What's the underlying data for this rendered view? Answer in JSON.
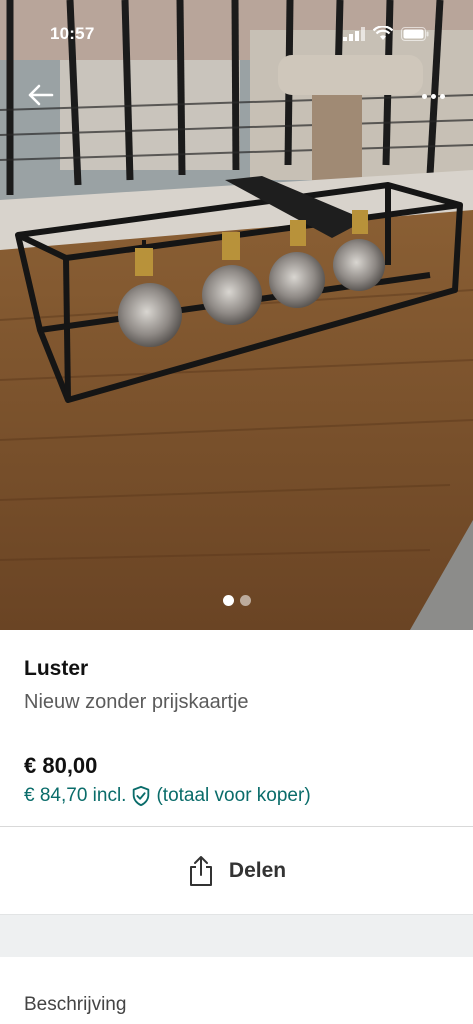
{
  "status_bar": {
    "time": "10:57"
  },
  "photo": {
    "alt": "Luster",
    "carousel_total": 2,
    "carousel_active": 0
  },
  "listing": {
    "title": "Luster",
    "subtitle": "Nieuw zonder prijskaartje",
    "price": "€ 80,00",
    "price_incl": "€ 84,70 incl.",
    "buyer_note": "(totaal voor koper)"
  },
  "actions": {
    "share_label": "Delen"
  },
  "section": {
    "description_title": "Beschrijving"
  },
  "colors": {
    "accent": "#0a6c6a",
    "text": "#111111",
    "muted": "#5b5b5b"
  }
}
